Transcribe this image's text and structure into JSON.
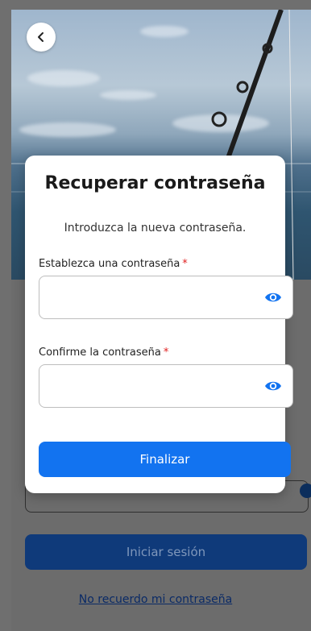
{
  "background": {
    "login_button_label": "Iniciar sesión",
    "forgot_password_link": "No recuerdo mi contraseña"
  },
  "modal": {
    "title": "Recuperar contraseña",
    "subtitle": "Introduzca la nueva contraseña.",
    "new_password": {
      "label": "Establezca una contraseña",
      "required_mark": "*",
      "value": ""
    },
    "confirm_password": {
      "label": "Confirme la contraseña",
      "required_mark": "*",
      "value": ""
    },
    "submit_label": "Finalizar"
  },
  "icons": {
    "back": "chevron-left-icon",
    "eye": "eye-icon"
  },
  "colors": {
    "primary": "#1273f0",
    "required": "#e02020",
    "link": "#0a2a66"
  }
}
